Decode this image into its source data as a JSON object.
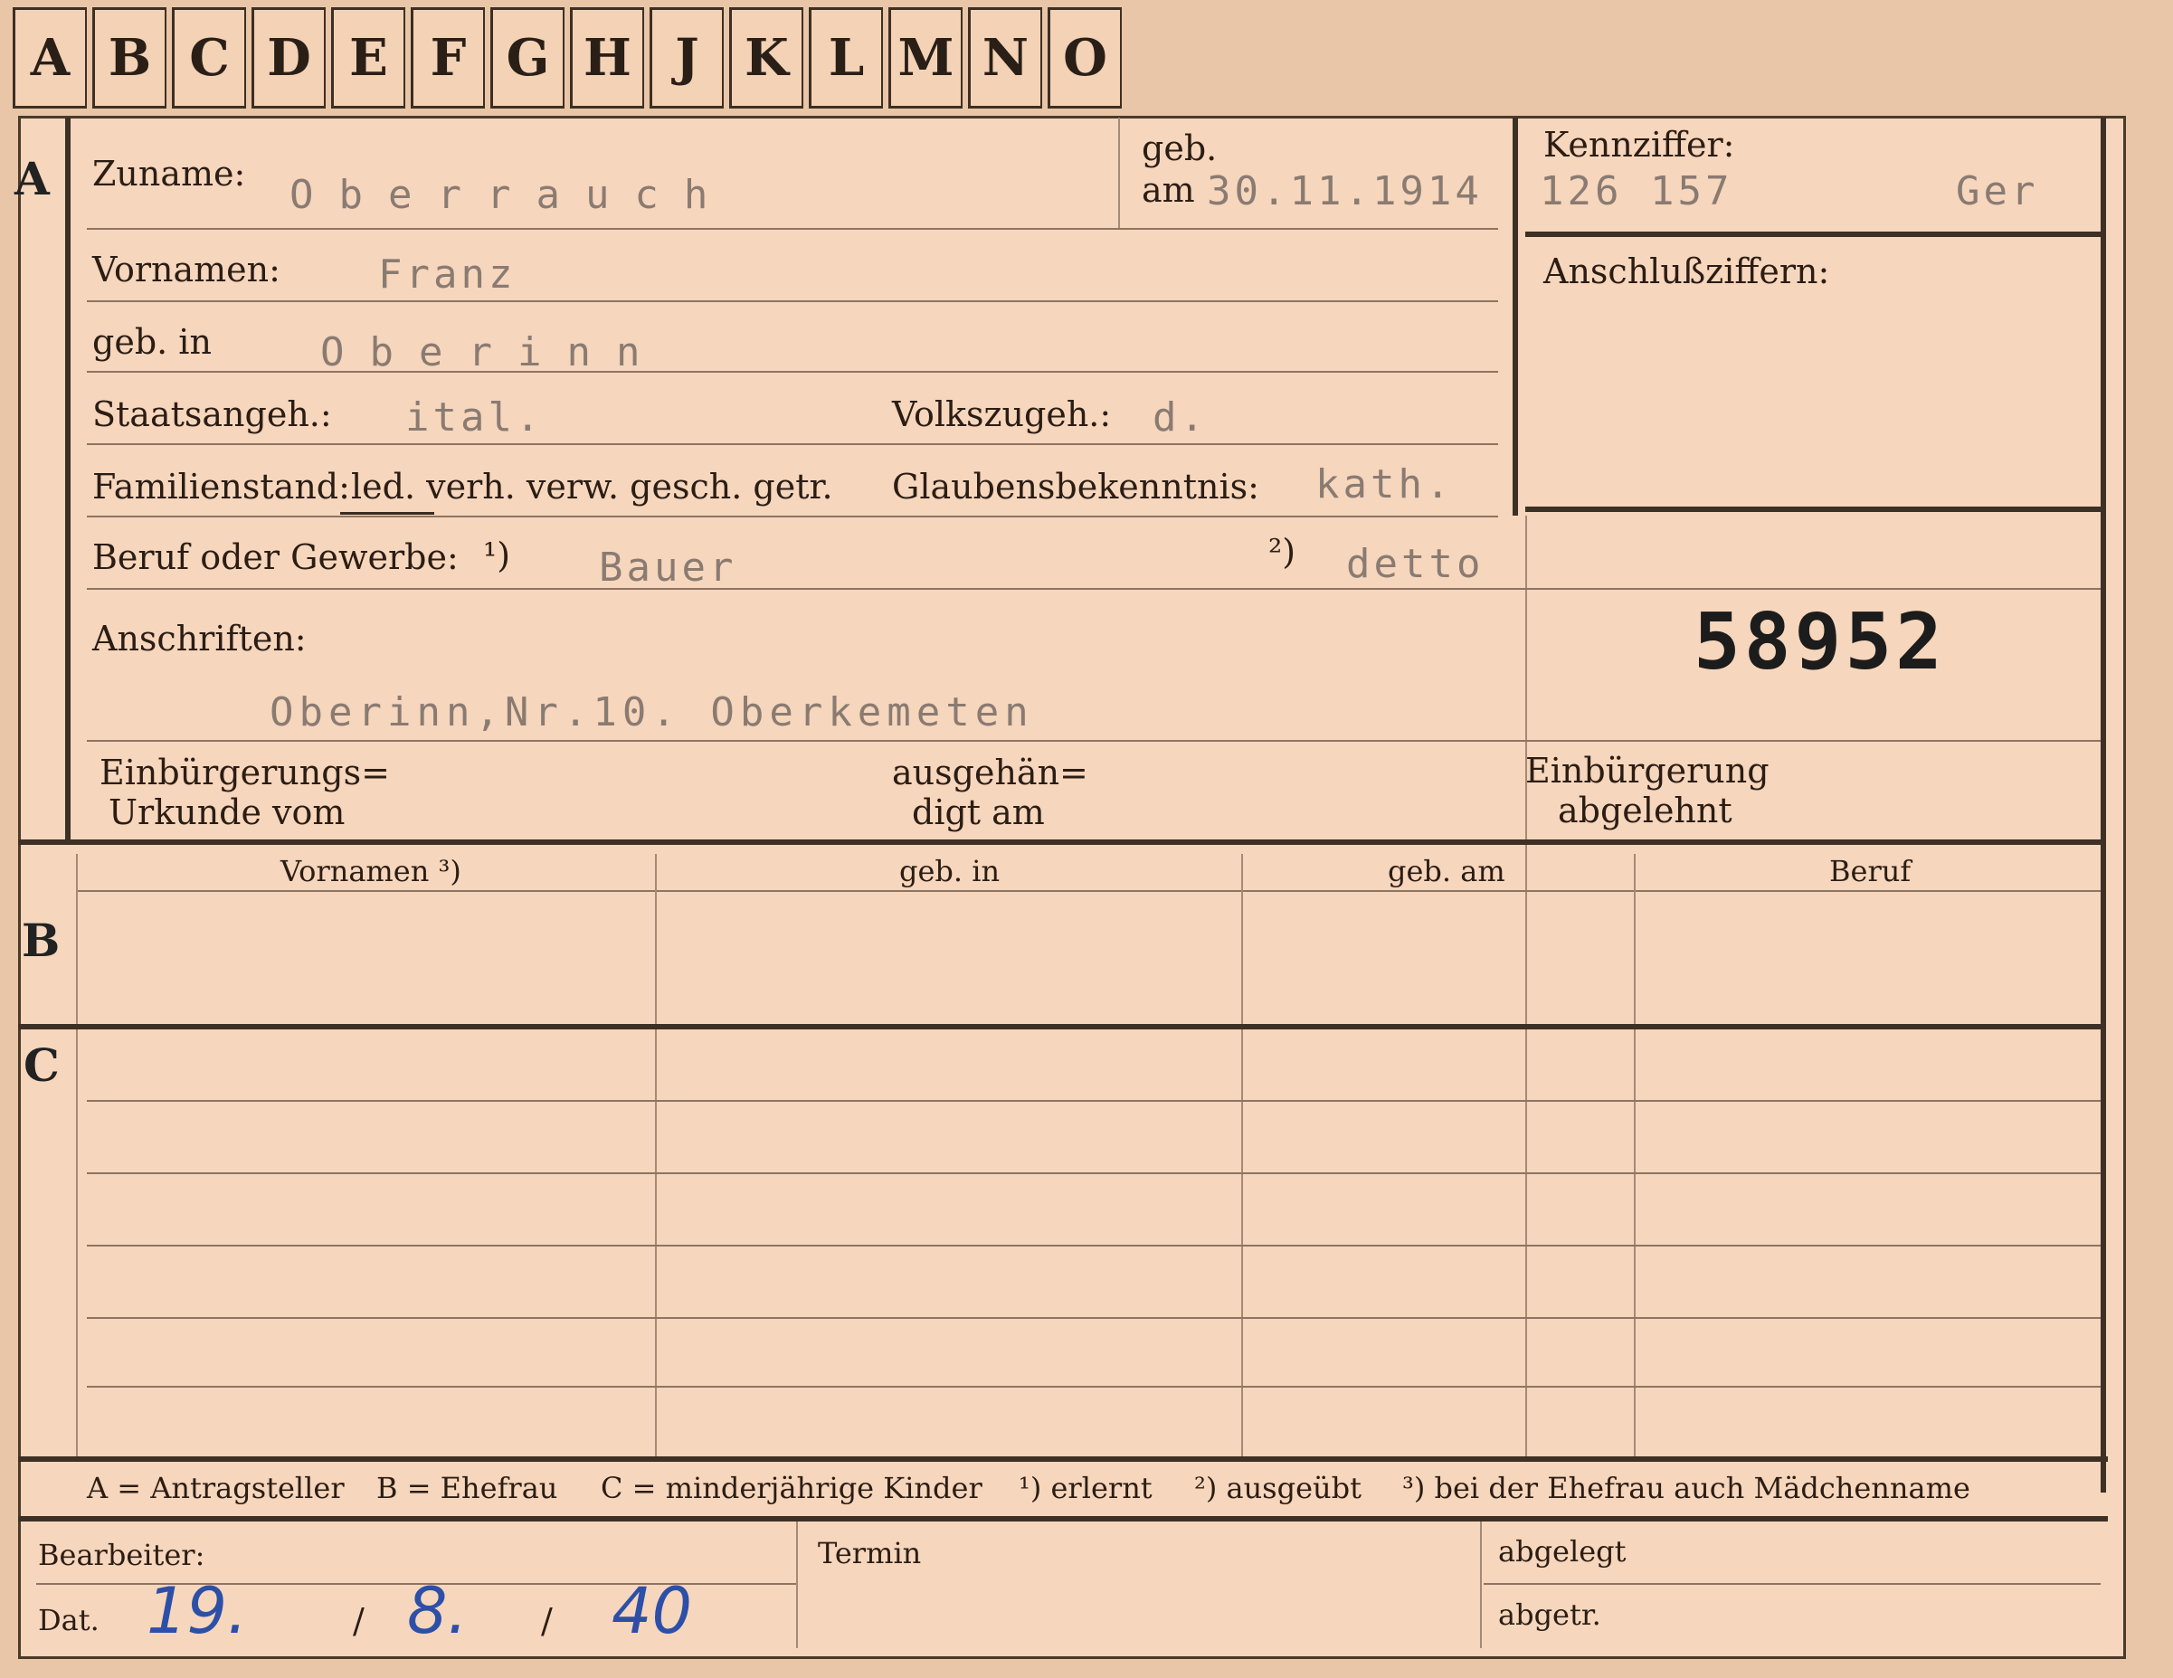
{
  "tabs": [
    "A",
    "B",
    "C",
    "D",
    "E",
    "F",
    "G",
    "H",
    "J",
    "K",
    "L",
    "M",
    "N",
    "O"
  ],
  "section_a": {
    "letter": "A",
    "zuname_label": "Zuname:",
    "zuname_value": "Oberrauch",
    "geb_label": "geb.",
    "am_label": "am",
    "geb_date": "30.11.1914",
    "kennziffer_label": "Kennziffer:",
    "kennziffer_value": "126 157",
    "kennziffer_suffix": "Ger",
    "anschluss_label": "Anschlußziffern:",
    "vornamen_label": "Vornamen:",
    "vornamen_value": "Franz",
    "gebin_label": "geb. in",
    "gebin_value": "Oberinn",
    "staat_label": "Staatsangeh.:",
    "staat_value": "ital.",
    "volks_label": "Volkszugeh.:",
    "volks_value": "d.",
    "familienstand_label": "Familienstand:",
    "familienstand_options": "led. verh. verw. gesch. getr.",
    "glaube_label": "Glaubensbekenntnis:",
    "glaube_value": "kath.",
    "beruf_label": "Beruf oder Gewerbe:",
    "beruf_mark1": "¹)",
    "beruf_value1": "Bauer",
    "beruf_mark2": "²)",
    "beruf_value2": "detto",
    "anschrift_label": "Anschriften:",
    "anschrift_value": "Oberinn,Nr.10. Oberkemeten",
    "card_number": "58952",
    "einbuerg_urk_1": "Einbürgerungs=",
    "einbuerg_urk_2": "Urkunde vom",
    "ausgeh_1": "ausgehän=",
    "ausgeh_2": "digt am",
    "einbuerg_abg_1": "Einbürgerung",
    "einbuerg_abg_2": "abgelehnt"
  },
  "section_b": {
    "letter": "B",
    "col_vornamen": "Vornamen ³)",
    "col_gebin": "geb. in",
    "col_gebam": "geb. am",
    "col_beruf": "Beruf"
  },
  "section_c": {
    "letter": "C"
  },
  "legend": {
    "a": "A = Antragsteller",
    "b": "B = Ehefrau",
    "c": "C = minderjährige Kinder",
    "n1": "¹) erlernt",
    "n2": "²) ausgeübt",
    "n3": "³) bei der Ehefrau auch Mädchenname"
  },
  "footer": {
    "bearbeiter_label": "Bearbeiter:",
    "dat_label": "Dat.",
    "day": "19.",
    "sep1": "/",
    "month": "8.",
    "sep2": "/",
    "year": "40",
    "termin_label": "Termin",
    "abgelegt_label": "abgelegt",
    "abgetr_label": "abgetr."
  },
  "colors": {
    "card": "#f6d6bc",
    "ink": "#2b1d14",
    "typewriter": "#8a7b72",
    "pen": "#2c4fa8"
  }
}
